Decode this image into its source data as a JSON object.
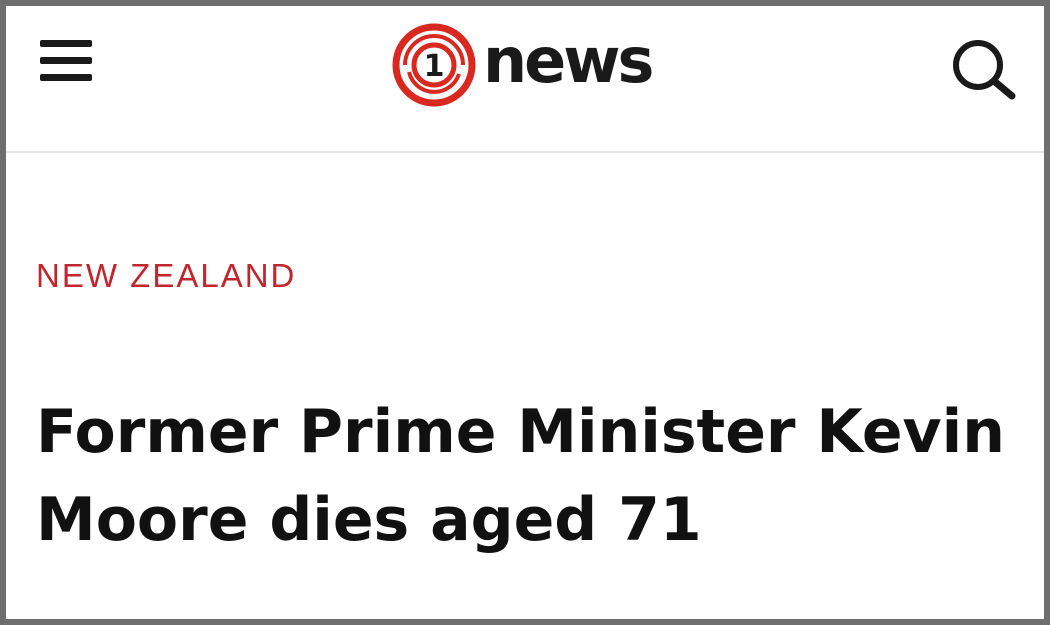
{
  "header": {
    "brand": {
      "mark_text": "1",
      "word": "news",
      "brand_color": "#d8281f"
    },
    "menu_icon": "hamburger-menu-icon",
    "search_icon": "search-icon"
  },
  "article": {
    "category": "NEW ZEALAND",
    "category_color": "#c0262d",
    "headline": "Former Prime Minister Kevin Moore dies aged 71"
  }
}
